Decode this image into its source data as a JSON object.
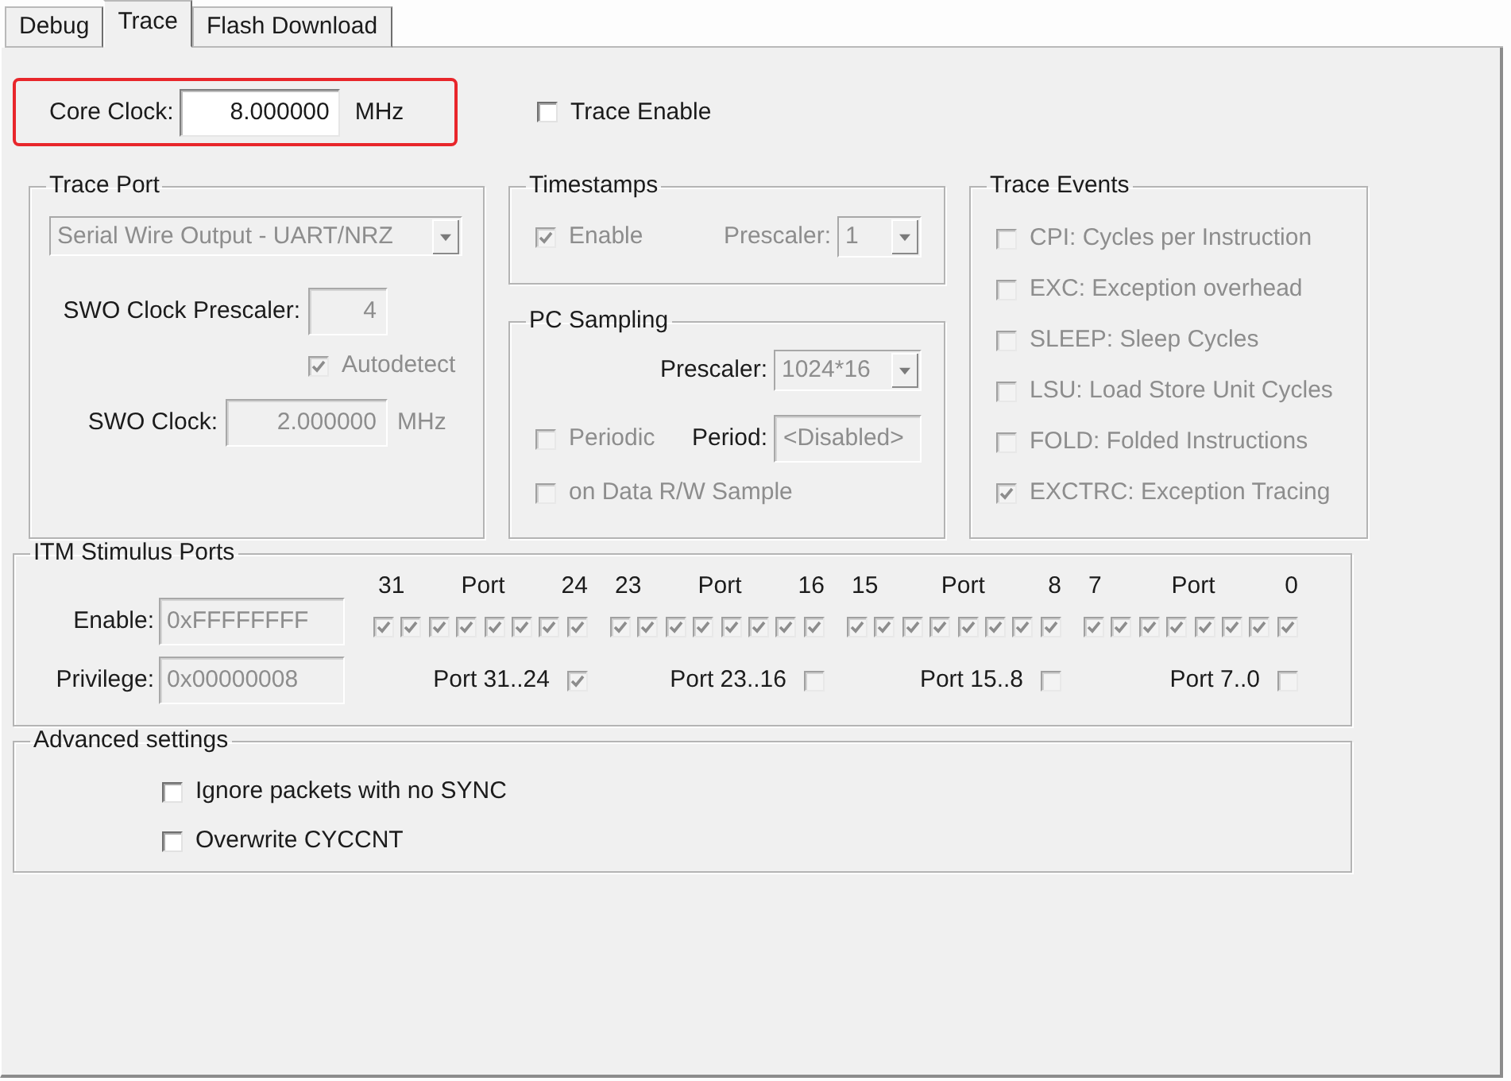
{
  "tabs": [
    {
      "label": "Debug",
      "selected": false
    },
    {
      "label": "Trace",
      "selected": true
    },
    {
      "label": "Flash Download",
      "selected": false
    }
  ],
  "core_clock": {
    "label": "Core Clock:",
    "value": "8.000000",
    "unit": "MHz",
    "highlighted": true
  },
  "trace_enable": {
    "label": "Trace Enable",
    "checked": false
  },
  "trace_port": {
    "title": "Trace Port",
    "port_select": {
      "value": "Serial Wire Output - UART/NRZ",
      "disabled": true
    },
    "swo_prescaler": {
      "label": "SWO Clock Prescaler:",
      "value": "4",
      "disabled": true,
      "label_disabled": false
    },
    "autodetect": {
      "label": "Autodetect",
      "checked": true,
      "disabled": true
    },
    "swo_clock": {
      "label": "SWO Clock:",
      "value": "2.000000",
      "unit": "MHz",
      "disabled": true,
      "label_disabled": false
    }
  },
  "timestamps": {
    "title": "Timestamps",
    "enable": {
      "label": "Enable",
      "checked": true,
      "disabled": true
    },
    "prescaler": {
      "label": "Prescaler:",
      "value": "1",
      "disabled": true,
      "label_disabled": true
    }
  },
  "pc_sampling": {
    "title": "PC Sampling",
    "prescaler": {
      "label": "Prescaler:",
      "value": "1024*16",
      "disabled": true,
      "label_disabled": false
    },
    "periodic": {
      "label": "Periodic",
      "checked": false,
      "disabled": true
    },
    "period": {
      "label": "Period:",
      "value": "<Disabled>",
      "disabled": true,
      "label_disabled": false
    },
    "on_data_sample": {
      "label": "on Data R/W Sample",
      "checked": false,
      "disabled": true
    }
  },
  "trace_events": {
    "title": "Trace Events",
    "items": [
      {
        "label": "CPI: Cycles per Instruction",
        "checked": false,
        "disabled": true
      },
      {
        "label": "EXC: Exception overhead",
        "checked": false,
        "disabled": true
      },
      {
        "label": "SLEEP: Sleep Cycles",
        "checked": false,
        "disabled": true
      },
      {
        "label": "LSU: Load Store Unit Cycles",
        "checked": false,
        "disabled": true
      },
      {
        "label": "FOLD: Folded Instructions",
        "checked": false,
        "disabled": true
      },
      {
        "label": "EXCTRC: Exception Tracing",
        "checked": true,
        "disabled": true
      }
    ]
  },
  "itm": {
    "title": "ITM Stimulus Ports",
    "enable": {
      "label": "Enable:",
      "value": "0xFFFFFFFF",
      "disabled": true
    },
    "privilege": {
      "label": "Privilege:",
      "value": "0x00000008",
      "disabled": true
    },
    "ports_disabled": true,
    "port_groups": [
      {
        "high": "31",
        "caption": "Port",
        "low": "24",
        "ports": [
          {
            "checked": true
          },
          {
            "checked": true
          },
          {
            "checked": true
          },
          {
            "checked": true
          },
          {
            "checked": true
          },
          {
            "checked": true
          },
          {
            "checked": true
          },
          {
            "checked": true
          }
        ],
        "privilege": {
          "label": "Port 31..24",
          "checked": true
        }
      },
      {
        "high": "23",
        "caption": "Port",
        "low": "16",
        "ports": [
          {
            "checked": true
          },
          {
            "checked": true
          },
          {
            "checked": true
          },
          {
            "checked": true
          },
          {
            "checked": true
          },
          {
            "checked": true
          },
          {
            "checked": true
          },
          {
            "checked": true
          }
        ],
        "privilege": {
          "label": "Port 23..16",
          "checked": false
        }
      },
      {
        "high": "15",
        "caption": "Port",
        "low": "8",
        "ports": [
          {
            "checked": true
          },
          {
            "checked": true
          },
          {
            "checked": true
          },
          {
            "checked": true
          },
          {
            "checked": true
          },
          {
            "checked": true
          },
          {
            "checked": true
          },
          {
            "checked": true
          }
        ],
        "privilege": {
          "label": "Port 15..8",
          "checked": false
        }
      },
      {
        "high": "7",
        "caption": "Port",
        "low": "0",
        "ports": [
          {
            "checked": true
          },
          {
            "checked": true
          },
          {
            "checked": true
          },
          {
            "checked": true
          },
          {
            "checked": true
          },
          {
            "checked": true
          },
          {
            "checked": true
          },
          {
            "checked": true
          }
        ],
        "privilege": {
          "label": "Port 7..0",
          "checked": false
        }
      }
    ]
  },
  "advanced": {
    "title": "Advanced settings",
    "options": [
      {
        "label": "Ignore packets with no SYNC",
        "checked": false,
        "disabled": false
      },
      {
        "label": "Overwrite CYCCNT",
        "checked": false,
        "disabled": false
      }
    ]
  }
}
